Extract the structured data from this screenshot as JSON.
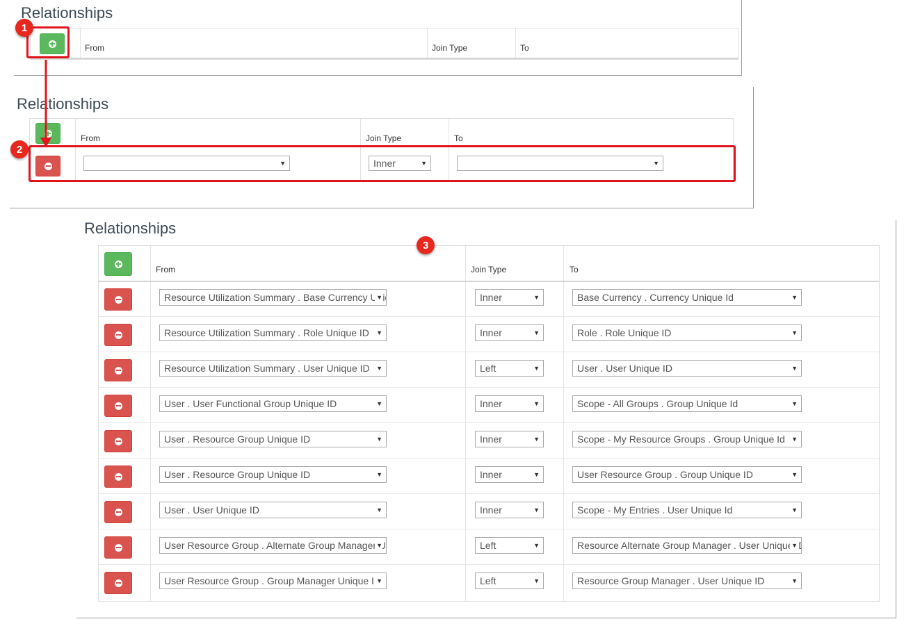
{
  "panel1": {
    "title": "Relationships",
    "columns": {
      "from": "From",
      "join_type": "Join Type",
      "to": "To"
    }
  },
  "panel2": {
    "title": "Relationships",
    "columns": {
      "from": "From",
      "join_type": "Join Type",
      "to": "To"
    },
    "row": {
      "from": "",
      "join": "Inner",
      "to": ""
    }
  },
  "panel3": {
    "title": "Relationships",
    "columns": {
      "from": "From",
      "join_type": "Join Type",
      "to": "To"
    },
    "rows": [
      {
        "from": "Resource Utilization Summary . Base Currency Unique Id",
        "join": "Inner",
        "to": "Base Currency . Currency Unique Id"
      },
      {
        "from": "Resource Utilization Summary . Role Unique ID",
        "join": "Inner",
        "to": "Role . Role Unique ID"
      },
      {
        "from": "Resource Utilization Summary . User Unique ID",
        "join": "Left",
        "to": "User . User Unique ID"
      },
      {
        "from": "User . User Functional Group Unique ID",
        "join": "Inner",
        "to": "Scope - All Groups . Group Unique Id"
      },
      {
        "from": "User . Resource Group Unique ID",
        "join": "Inner",
        "to": "Scope - My Resource Groups . Group Unique Id"
      },
      {
        "from": "User . Resource Group Unique ID",
        "join": "Inner",
        "to": "User Resource Group . Group Unique ID"
      },
      {
        "from": "User . User Unique ID",
        "join": "Inner",
        "to": "Scope - My Entries . User Unique Id"
      },
      {
        "from": "User Resource Group . Alternate Group Manager Unique ID",
        "join": "Left",
        "to": "Resource Alternate Group Manager . User Unique ID"
      },
      {
        "from": "User Resource Group . Group Manager Unique ID",
        "join": "Left",
        "to": "Resource Group Manager . User Unique ID"
      }
    ]
  },
  "callouts": [
    "1",
    "2",
    "3"
  ],
  "icons": {
    "add": "plus-circle-icon",
    "remove": "minus-circle-icon",
    "dropdown": "caret-down-icon"
  },
  "colors": {
    "add_button": "#5cb85c",
    "remove_button": "#d9534f",
    "callout": "#e8271f",
    "highlight": "#e0141c"
  }
}
